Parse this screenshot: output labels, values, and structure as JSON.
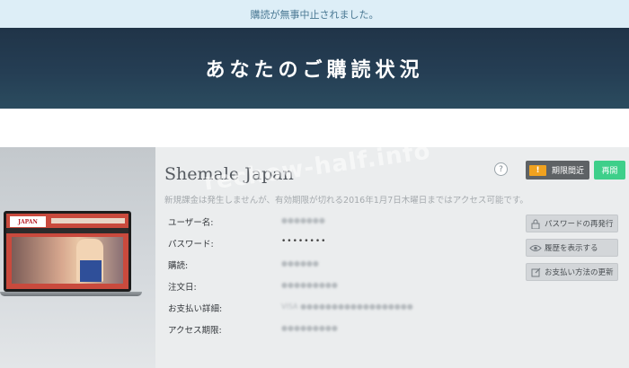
{
  "notice": "購読が無事中止されました。",
  "hero_title": "あなたのご購読状況",
  "subscription": {
    "site_name": "Shemale Japan",
    "note": "新規課金は発生しませんが、有効期限が切れる2016年1月7日木曜日まではアクセス可能です。",
    "rows": [
      {
        "label": "ユーザー名:",
        "value": "●●●●●●●"
      },
      {
        "label": "パスワード:",
        "value": "••••••••"
      },
      {
        "label": "購読:",
        "value": "●●●●●●"
      },
      {
        "label": "注文日:",
        "value": "●●●●●●●●●"
      },
      {
        "label": "お支払い詳細:",
        "value": "VISA ●●●●●●●●●●●●●●●●●●"
      },
      {
        "label": "アクセス期限:",
        "value": "●●●●●●●●●"
      }
    ]
  },
  "help_glyph": "?",
  "status_badge": {
    "icon_text": "!",
    "label": "期限間近"
  },
  "renew_label": "再開",
  "actions": [
    {
      "label": "パスワードの再発行",
      "icon": "lock-icon"
    },
    {
      "label": "履歴を表示する",
      "icon": "eye-icon"
    },
    {
      "label": "お支払い方法の更新",
      "icon": "edit-icon"
    }
  ],
  "thumbnail": {
    "logo_text": "JAPAN"
  },
  "watermark": "rechow-half.info",
  "colors": {
    "hero_bg": "#253e54",
    "renew": "#3ecf8a",
    "warning": "#f0a21f",
    "notice_bg": "#ddeef7"
  }
}
